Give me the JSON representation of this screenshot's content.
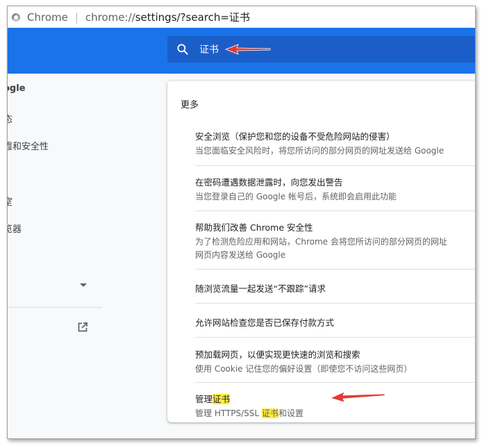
{
  "address_bar": {
    "app_name": "Chrome",
    "url_prefix": "chrome://",
    "url_rest": "settings/?search=证书"
  },
  "search": {
    "query": "证书"
  },
  "sidebar": {
    "items": [
      "ogle",
      "态",
      "霞和安全性",
      "",
      "室",
      "览器"
    ]
  },
  "section": {
    "title": "更多"
  },
  "settings_rows": [
    {
      "title": "安全浏览（保护您和您的设备不受危险网站的侵害）",
      "subtitle": "当您面临安全风险时，将您所访问的部分网页的网址发送给 Google"
    },
    {
      "title": "在密码遭遇数据泄露时，向您发出警告",
      "subtitle": "当您登录自己的 Google 帐号后，系统即会启用此功能"
    },
    {
      "title": "帮助我们改善 Chrome 安全性",
      "subtitle": "为了检测危险应用和网站，Chrome 会将您所访问的部分网页的网址",
      "subtitle2": "网页内容发送给 Google"
    },
    {
      "title": "随浏览流量一起发送“不跟踪”请求"
    },
    {
      "title": "允许网站检查您是否已保存付款方式"
    },
    {
      "title": "预加载网页，以便实现更快速的浏览和搜索",
      "subtitle": "使用 Cookie 记住您的偏好设置（即使您不访问这些网页）"
    },
    {
      "title_pre": "管理",
      "title_mark": "证书",
      "subtitle_pre": "管理 HTTPS/SSL ",
      "subtitle_mark": "证书",
      "subtitle_post": "和设置"
    }
  ],
  "icons": {
    "search": "search-icon",
    "external_link": "open-in-new-icon",
    "dropdown": "caret-down-icon",
    "chrome": "chrome-logo-icon"
  },
  "colors": {
    "toolbar": "#1a73e8",
    "search_box": "#1b5ec8",
    "highlight": "#ffeb3b",
    "annotation": "#e53935"
  }
}
